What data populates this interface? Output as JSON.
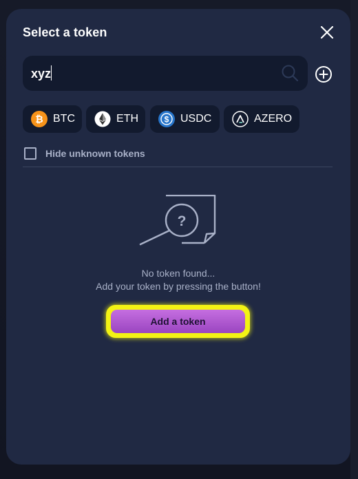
{
  "modal": {
    "title": "Select a token",
    "search": {
      "value": "xyz",
      "placeholder": ""
    },
    "quick_tokens": [
      {
        "label": "BTC",
        "icon": "bitcoin-icon",
        "color": "#f7931a"
      },
      {
        "label": "ETH",
        "icon": "ethereum-icon",
        "color": "#ffffff"
      },
      {
        "label": "USDC",
        "icon": "usdc-icon",
        "color": "#2775ca"
      },
      {
        "label": "AZERO",
        "icon": "aleph-zero-icon",
        "color": "#ffffff"
      }
    ],
    "hide_unknown_label": "Hide unknown tokens",
    "hide_unknown_checked": false,
    "empty_state": {
      "line1": "No token found...",
      "line2": "Add your token by pressing the button!",
      "button_label": "Add a token"
    }
  },
  "colors": {
    "modal_bg": "#202943",
    "input_bg": "#121a2e",
    "muted_text": "#a9b1c8",
    "highlight": "#f3f314",
    "button_top": "#c56ee0",
    "button_bottom": "#9a45c0"
  }
}
